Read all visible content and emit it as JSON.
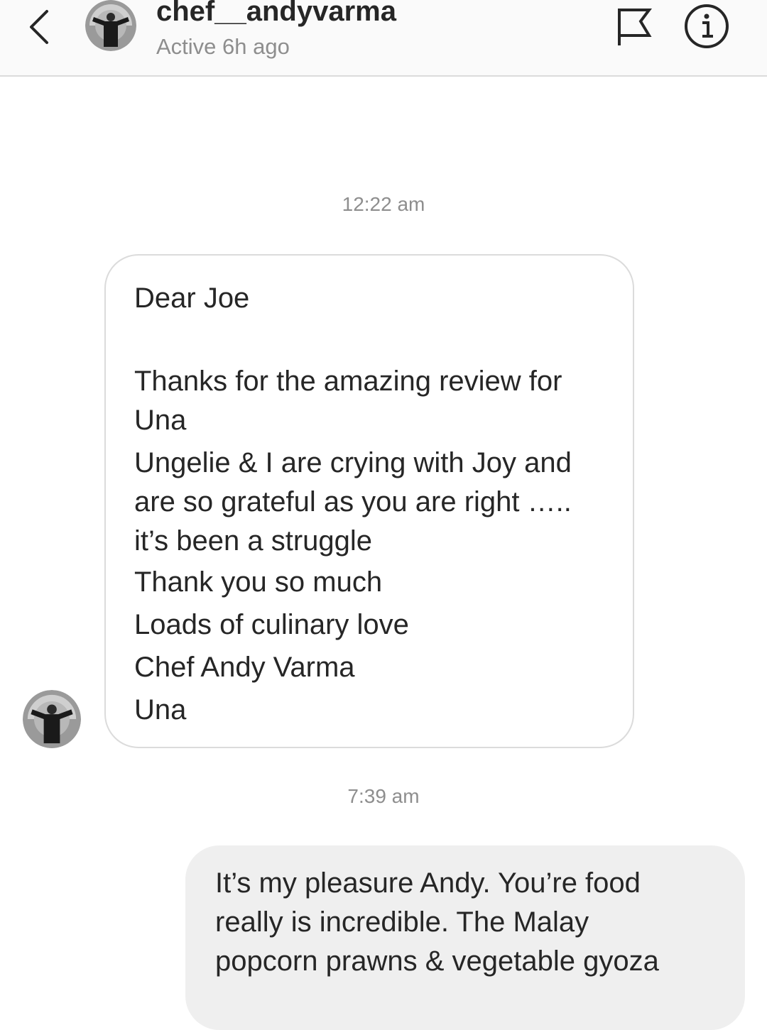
{
  "header": {
    "username": "chef__andyvarma",
    "status": "Active 6h ago"
  },
  "thread": {
    "timestamp_1": "12:22 am",
    "incoming_message": {
      "greeting": "Dear Joe",
      "line_1": "Thanks for the amazing review for Una",
      "line_2": "Ungelie & I are crying with Joy and are so grateful as you are right ….. it’s been a struggle",
      "line_3": "Thank you so much",
      "line_4": "Loads of culinary love",
      "line_5": "Chef Andy Varma",
      "line_6": "Una"
    },
    "timestamp_2": "7:39 am",
    "outgoing_message": {
      "line_1": "It’s my pleasure Andy. You’re food",
      "line_2": "really is incredible. The Malay",
      "line_3": "popcorn prawns & vegetable gyoza"
    }
  },
  "icons": {
    "back": "chevron-left",
    "flag": "flag",
    "info": "info-circle"
  }
}
